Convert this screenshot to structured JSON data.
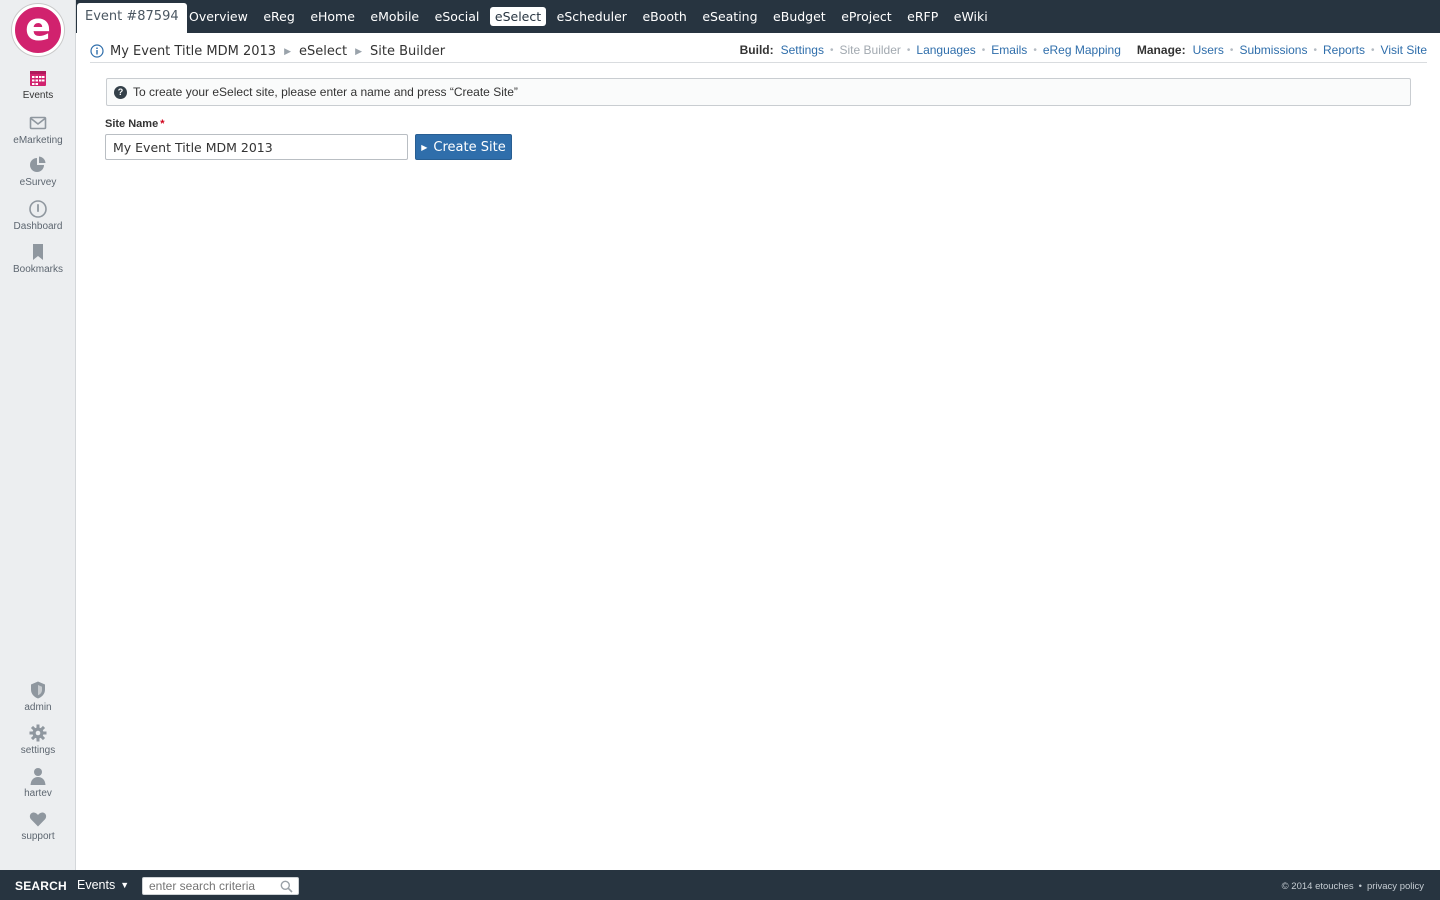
{
  "app": {
    "logo_letter": "e",
    "brand_color": "#d1226e"
  },
  "sidebar": {
    "items": [
      {
        "label": "Events",
        "icon": "calendar-icon"
      },
      {
        "label": "eMarketing",
        "icon": "envelope-icon"
      },
      {
        "label": "eSurvey",
        "icon": "pie-chart-icon"
      },
      {
        "label": "Dashboard",
        "icon": "gauge-icon"
      },
      {
        "label": "Bookmarks",
        "icon": "bookmark-icon"
      }
    ],
    "bottom_items": [
      {
        "label": "admin",
        "icon": "shield-icon"
      },
      {
        "label": "settings",
        "icon": "gear-icon"
      },
      {
        "label": "hartev",
        "icon": "user-icon"
      },
      {
        "label": "support",
        "icon": "heart-icon"
      }
    ]
  },
  "topnav": {
    "event_tab": "Event #87594",
    "items": [
      "Overview",
      "eReg",
      "eHome",
      "eMobile",
      "eSocial",
      "eSelect",
      "eScheduler",
      "eBooth",
      "eSeating",
      "eBudget",
      "eProject",
      "eRFP",
      "eWiki"
    ],
    "active": "eSelect"
  },
  "breadcrumb": {
    "items": [
      "My Event Title MDM 2013",
      "eSelect",
      "Site Builder"
    ]
  },
  "build": {
    "title": "Build:",
    "links": [
      "Settings",
      "Site Builder",
      "Languages",
      "Emails",
      "eReg Mapping"
    ],
    "current": "Site Builder"
  },
  "manage": {
    "title": "Manage:",
    "links": [
      "Users",
      "Submissions",
      "Reports",
      "Visit Site"
    ]
  },
  "notice": {
    "text": "To create your eSelect site, please enter a name and press “Create Site”"
  },
  "form": {
    "site_name_label": "Site Name",
    "required_mark": "*",
    "site_name_value": "My Event Title MDM 2013",
    "create_button": "Create Site"
  },
  "footer": {
    "search_label": "SEARCH",
    "scope": "Events",
    "search_placeholder": "enter search criteria",
    "copyright": "© 2014 etouches",
    "privacy": "privacy policy"
  }
}
